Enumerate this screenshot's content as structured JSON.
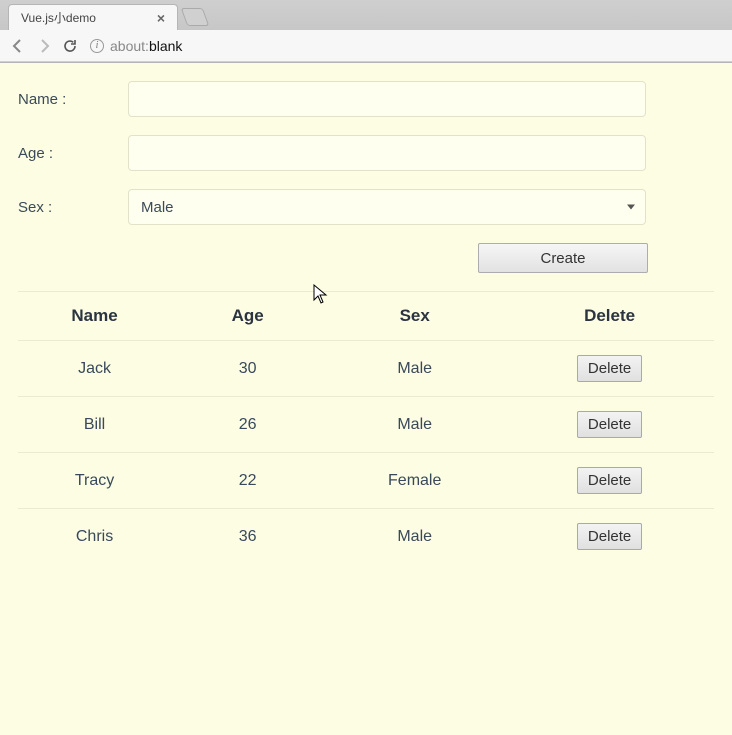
{
  "browser": {
    "tab_title": "Vue.js小demo",
    "url_prefix": "about:",
    "url_bold": "blank"
  },
  "form": {
    "name_label": "Name :",
    "name_value": "",
    "age_label": "Age :",
    "age_value": "",
    "sex_label": "Sex :",
    "sex_selected": "Male",
    "create_label": "Create"
  },
  "table": {
    "headers": {
      "name": "Name",
      "age": "Age",
      "sex": "Sex",
      "delete": "Delete"
    },
    "delete_label": "Delete",
    "rows": [
      {
        "name": "Jack",
        "age": "30",
        "sex": "Male"
      },
      {
        "name": "Bill",
        "age": "26",
        "sex": "Male"
      },
      {
        "name": "Tracy",
        "age": "22",
        "sex": "Female"
      },
      {
        "name": "Chris",
        "age": "36",
        "sex": "Male"
      }
    ]
  }
}
